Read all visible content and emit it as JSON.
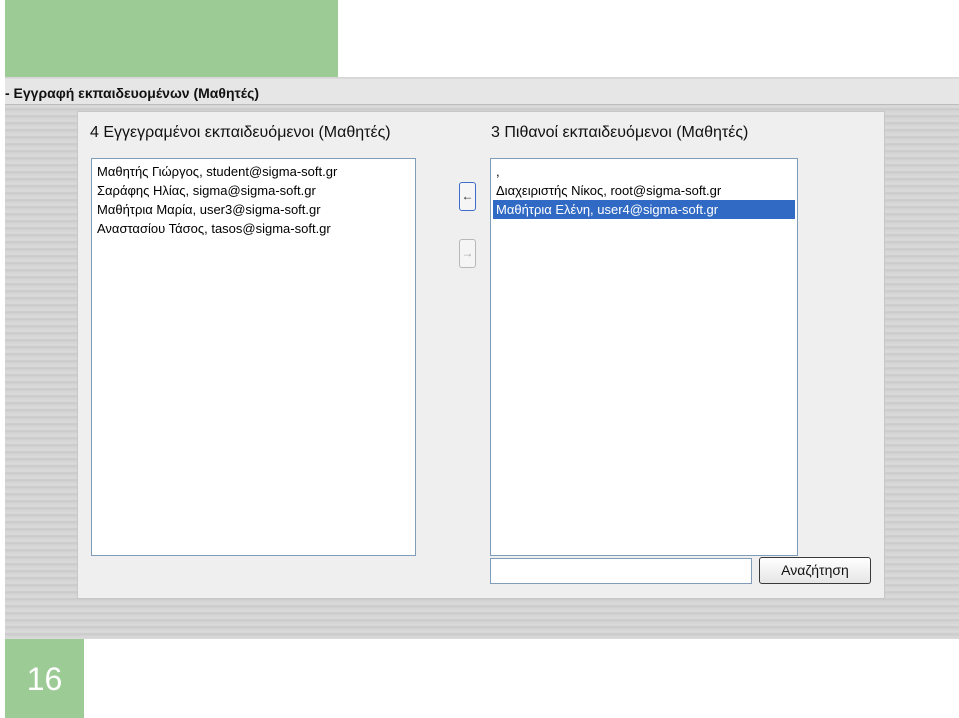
{
  "slide": {
    "page_number": "16",
    "accent_color": "#9dcb96"
  },
  "window": {
    "title": "- Εγγραφή εκπαιδευομένων (Μαθητές)"
  },
  "enrolled": {
    "heading": "4 Εγγεγραμένοι εκπαιδευόμενοι (Μαθητές)",
    "items": [
      "Μαθητής Γιώργος, student@sigma-soft.gr",
      "Σαράφης Ηλίας, sigma@sigma-soft.gr",
      "Μαθήτρια Μαρία, user3@sigma-soft.gr",
      "Αναστασίου Τάσος, tasos@sigma-soft.gr"
    ]
  },
  "potential": {
    "heading": "3 Πιθανοί εκπαιδευόμενοι (Μαθητές)",
    "items": [
      ",",
      "Διαχειριστής Νίκος, root@sigma-soft.gr",
      "Μαθήτρια Ελένη, user4@sigma-soft.gr"
    ],
    "selected_index": 2
  },
  "buttons": {
    "add_label": "←",
    "remove_label": "→"
  },
  "search": {
    "value": "",
    "placeholder": "",
    "button_label": "Αναζήτηση"
  }
}
